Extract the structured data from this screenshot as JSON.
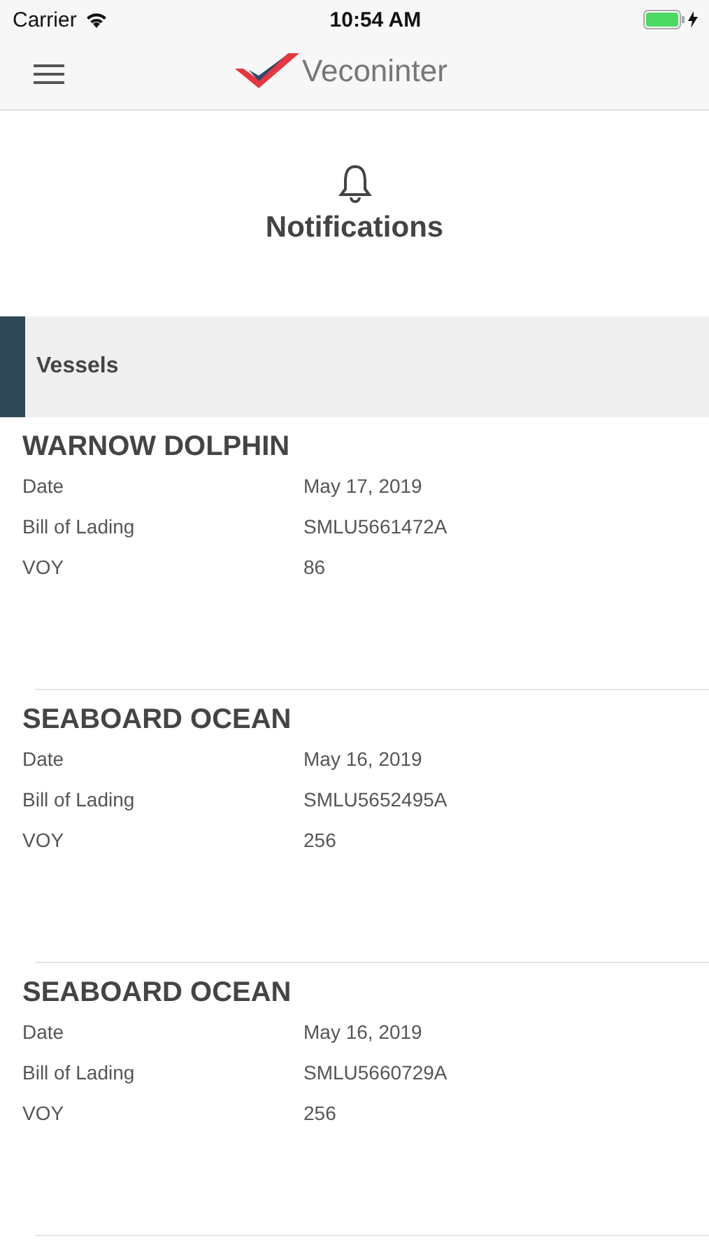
{
  "status_bar": {
    "carrier": "Carrier",
    "time": "10:54 AM"
  },
  "nav": {
    "brand": "Veconinter"
  },
  "header": {
    "title": "Notifications"
  },
  "section": {
    "title": "Vessels"
  },
  "notifications": [
    {
      "vessel": "WARNOW DOLPHIN",
      "fields": [
        {
          "label": "Date",
          "value": "May 17, 2019"
        },
        {
          "label": "Bill of Lading",
          "value": "SMLU5661472A"
        },
        {
          "label": "VOY",
          "value": "86"
        }
      ]
    },
    {
      "vessel": "SEABOARD OCEAN",
      "fields": [
        {
          "label": "Date",
          "value": "May 16, 2019"
        },
        {
          "label": "Bill of Lading",
          "value": "SMLU5652495A"
        },
        {
          "label": "VOY",
          "value": "256"
        }
      ]
    },
    {
      "vessel": "SEABOARD OCEAN",
      "fields": [
        {
          "label": "Date",
          "value": "May 16, 2019"
        },
        {
          "label": "Bill of Lading",
          "value": "SMLU5660729A"
        },
        {
          "label": "VOY",
          "value": "256"
        }
      ]
    }
  ]
}
